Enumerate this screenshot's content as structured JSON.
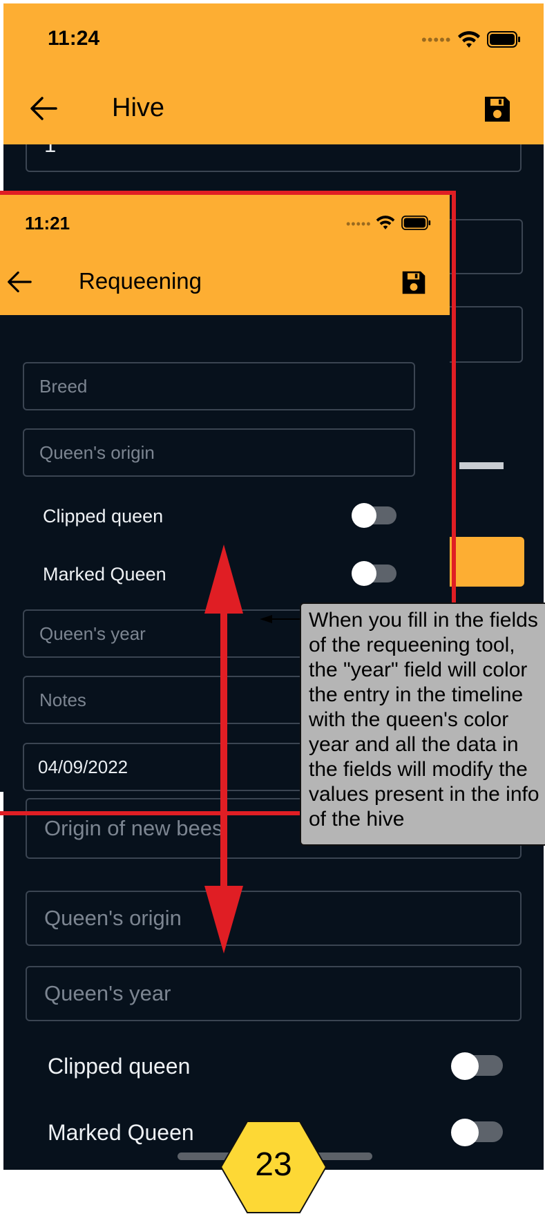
{
  "back_screen": {
    "status_time": "11:24",
    "title": "Hive",
    "field_1_value": "1",
    "origin_bees_placeholder": "Origin of new bees",
    "queen_origin_placeholder": "Queen's origin",
    "queen_year_placeholder": "Queen's year",
    "clipped_queen_label": "Clipped queen",
    "marked_queen_label": "Marked Queen",
    "clipped_queen_on": false,
    "marked_queen_on": false
  },
  "front_screen": {
    "status_time": "11:21",
    "title": "Requeening",
    "breed_placeholder": "Breed",
    "queen_origin_placeholder": "Queen's origin",
    "clipped_queen_label": "Clipped queen",
    "marked_queen_label": "Marked Queen",
    "clipped_queen_on": false,
    "marked_queen_on": false,
    "queen_year_placeholder": "Queen's year",
    "notes_placeholder": "Notes",
    "date_value": "04/09/2022"
  },
  "annotation": {
    "callout_text": "When you fill in the fields\nof the requeening tool,\nthe \"year\" field will color\nthe entry in the timeline\nwith the queen's color\nyear and all the data in\nthe fields will modify the\nvalues present in the info\nof the hive",
    "page_number": "23"
  },
  "colors": {
    "appbar": "#fdae33",
    "background": "#07111c",
    "highlight_red": "#e01e24",
    "badge_yellow": "#fdd835"
  },
  "icons": [
    "back-arrow-icon",
    "save-icon",
    "wifi-icon",
    "battery-icon",
    "cellular-dots-icon"
  ]
}
